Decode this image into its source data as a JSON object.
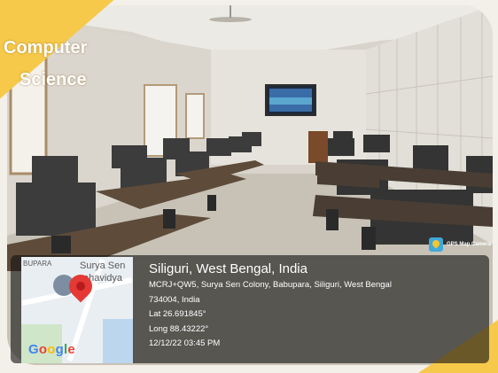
{
  "overlay": {
    "ribbon": {
      "line1": "Computer",
      "line2": "Science",
      "color": "#f6c94a"
    },
    "app_badge": {
      "icon": "map-pin-icon",
      "label": "GPS Map Camera"
    },
    "location": {
      "title": "Siliguri, West Bengal, India",
      "address_line1": "MCRJ+QW5, Surya Sen Colony, Babupara, Siliguri, West Bengal",
      "address_line2": "734004, India",
      "lat": "Lat 26.691845°",
      "long": "Long 88.43222°",
      "datetime": "12/12/22 03:45 PM"
    },
    "map": {
      "label_left": "BUPARA",
      "label_top": "Surya Sen",
      "label_top2": "ahavidya",
      "provider": [
        "G",
        "o",
        "o",
        "g",
        "l",
        "e"
      ],
      "pin_icon": "location-pin-icon"
    }
  }
}
